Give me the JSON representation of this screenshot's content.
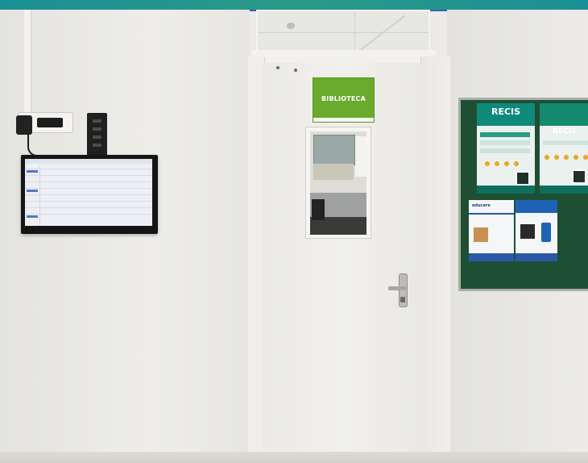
{
  "scene": {
    "door_sign": {
      "label": "BIBLIOTECA",
      "color": "#6aaa2c"
    },
    "top_bar": {
      "color": "#1a8f96",
      "border_color": "#3a5fb8"
    },
    "bulletin_board": {
      "frame_color": "#1f4f33",
      "posters": [
        {
          "logo": "RECIS"
        },
        {
          "logo": "RECIS"
        }
      ],
      "flyers": [
        {
          "title": "educare"
        },
        {
          "title": ""
        }
      ]
    },
    "tv_screen": {
      "header": ""
    }
  }
}
